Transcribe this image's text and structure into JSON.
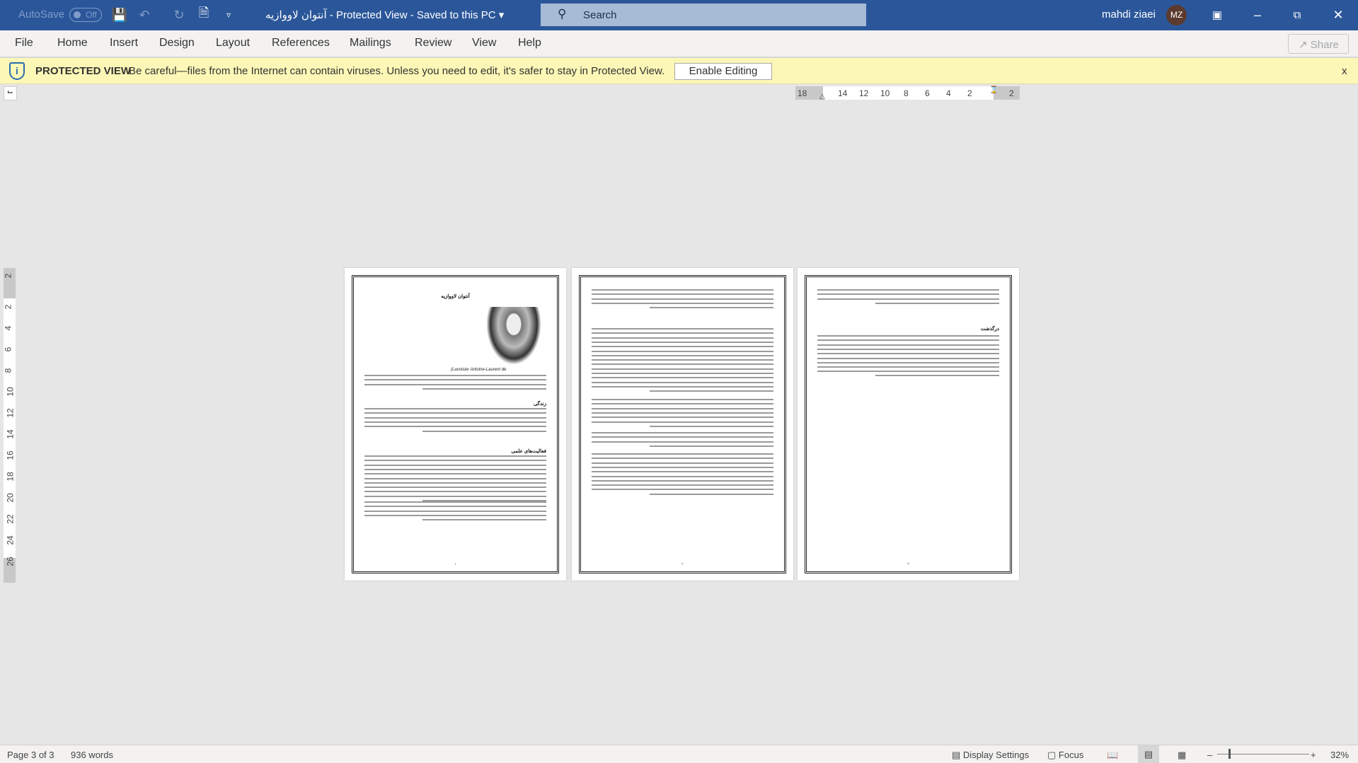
{
  "titlebar": {
    "autosave": "AutoSave",
    "autosave_state": "Off",
    "doc_title": "آنتوان لاووازیه",
    "title_suffix": " -  Protected View  -  Saved to this PC",
    "search_placeholder": "Search",
    "user_name": "mahdi ziaei",
    "avatar_initials": "MZ",
    "accent": "#2b579a"
  },
  "ribbon": {
    "tabs": [
      "File",
      "Home",
      "Insert",
      "Design",
      "Layout",
      "References",
      "Mailings",
      "Review",
      "View",
      "Help"
    ],
    "share": "Share"
  },
  "protected_view": {
    "label": "PROTECTED VIEW",
    "message": "Be careful—files from the Internet can contain viruses. Unless you need to edit, it's safer to stay in Protected View.",
    "button": "Enable Editing",
    "close": "x",
    "bg": "#fcf7b6"
  },
  "ruler": {
    "h_ticks": [
      "18",
      "14",
      "12",
      "10",
      "8",
      "6",
      "4",
      "2",
      "2"
    ],
    "v_ticks": [
      "2",
      "2",
      "4",
      "6",
      "8",
      "10",
      "12",
      "14",
      "16",
      "18",
      "20",
      "22",
      "24",
      "26"
    ]
  },
  "pages": [
    {
      "title": "آنتوان لاووازیه",
      "headings": [
        "زندگی",
        "فعالیت‌های علمی"
      ],
      "latin": "(Lavoisier Antoine-Laurent de",
      "number": "۱"
    },
    {
      "headings": [],
      "number": "۲"
    },
    {
      "headings": [
        "درگذشت"
      ],
      "number": "۳"
    }
  ],
  "status": {
    "page": "Page 3 of 3",
    "words": "936 words",
    "display_settings": "Display Settings",
    "focus": "Focus",
    "zoom": "32%"
  }
}
